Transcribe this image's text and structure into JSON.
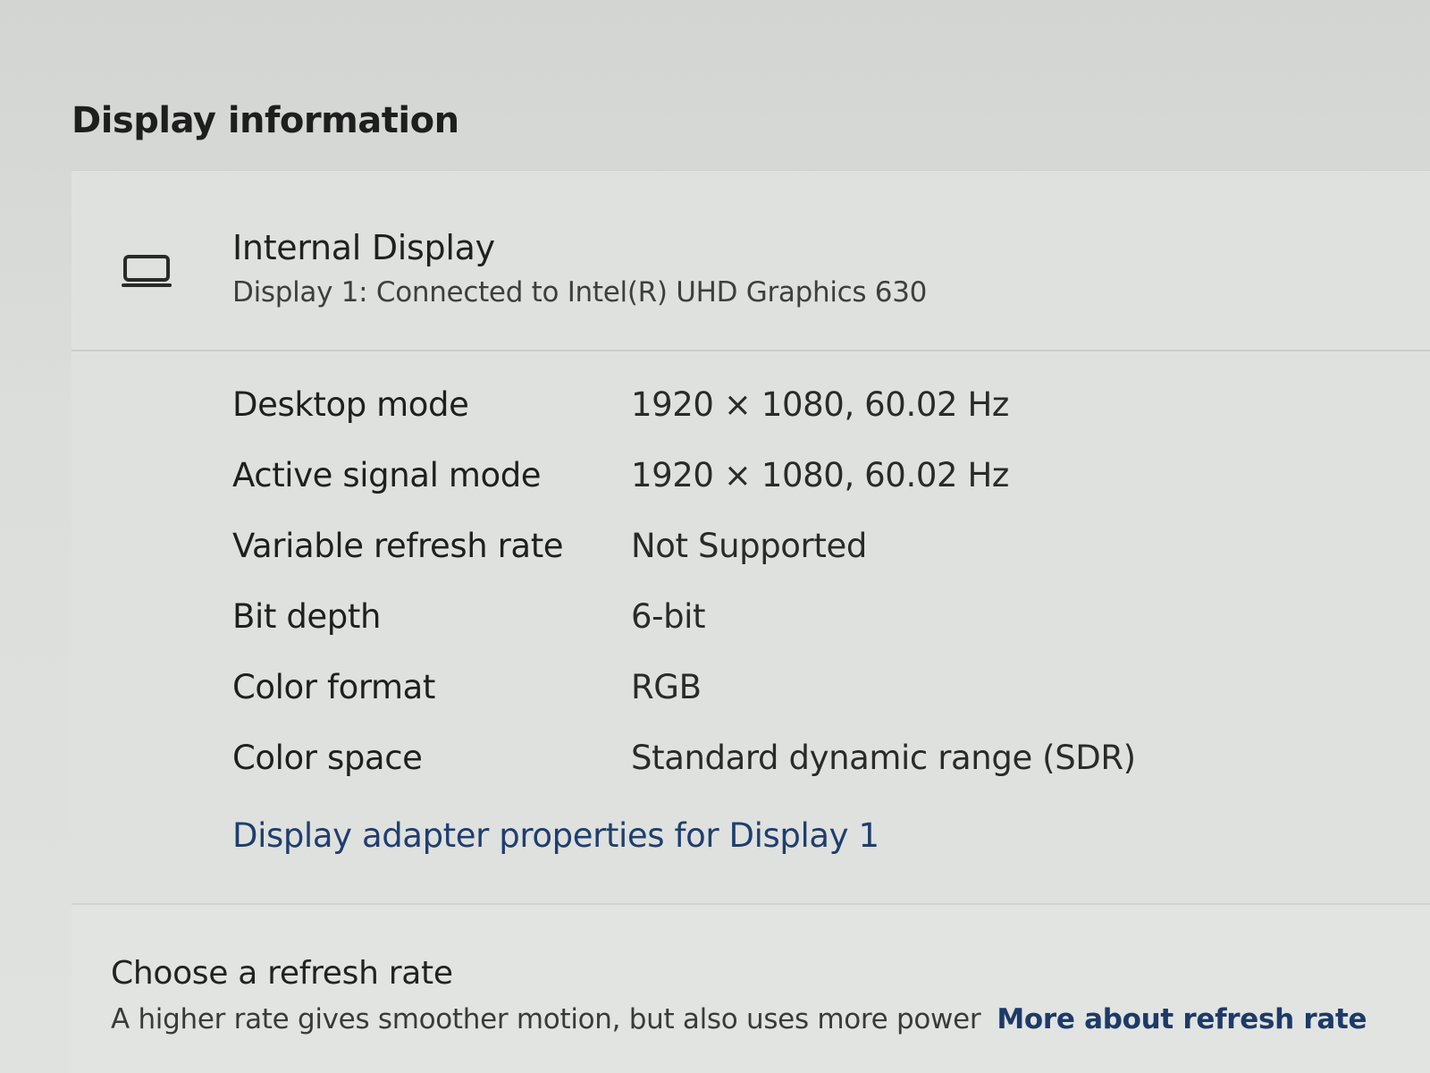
{
  "section": {
    "title": "Display information"
  },
  "display": {
    "icon": "laptop-monitor-icon",
    "name": "Internal Display",
    "subtitle": "Display 1: Connected to Intel(R) UHD Graphics 630"
  },
  "info_rows": [
    {
      "label": "Desktop mode",
      "value": "1920 × 1080, 60.02 Hz"
    },
    {
      "label": "Active signal mode",
      "value": "1920 × 1080, 60.02 Hz"
    },
    {
      "label": "Variable refresh rate",
      "value": "Not Supported"
    },
    {
      "label": "Bit depth",
      "value": "6-bit"
    },
    {
      "label": "Color format",
      "value": "RGB"
    },
    {
      "label": "Color space",
      "value": "Standard dynamic range (SDR)"
    }
  ],
  "adapter_link": "Display adapter properties for Display 1",
  "refresh": {
    "title": "Choose a refresh rate",
    "description": "A higher rate gives smoother motion, but also uses more power",
    "link": "More about refresh rate"
  },
  "colors": {
    "link": "#1f3e6e",
    "text": "#1b1b1b",
    "background": "#dcdedc"
  }
}
